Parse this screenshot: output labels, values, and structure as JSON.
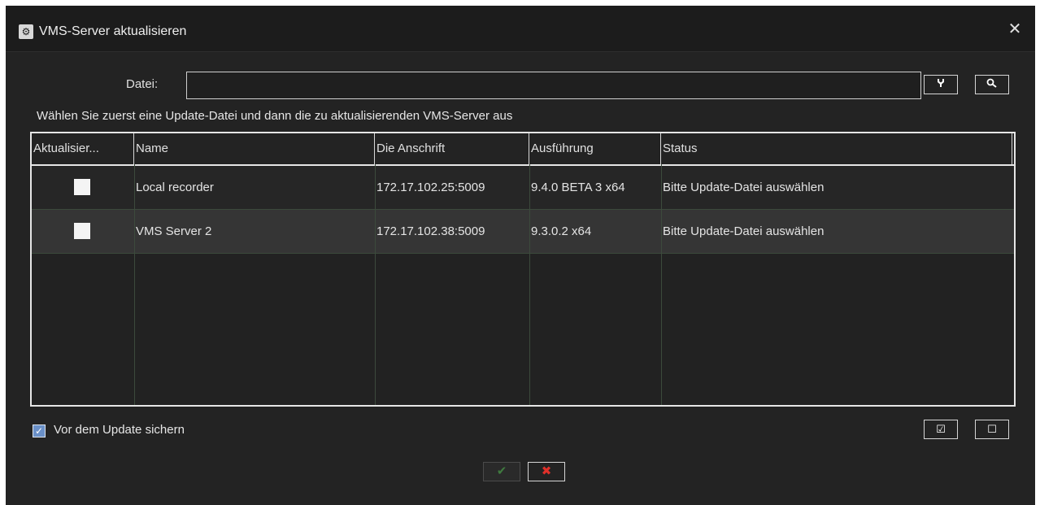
{
  "window": {
    "title": "VMS-Server aktualisieren",
    "close_glyph": "✕",
    "title_icon": "gear-icon"
  },
  "file": {
    "label": "Datei:",
    "value": "",
    "placeholder": "",
    "browse_icon": "wrench-icon",
    "search_icon": "search-icon"
  },
  "hint": "Wählen Sie zuerst eine Update-Datei und dann die zu aktualisierenden VMS-Server aus",
  "table": {
    "columns": [
      "Aktualisier...",
      "Name",
      "Die Anschrift",
      "Ausführung",
      "Status"
    ],
    "rows": [
      {
        "checked": false,
        "name": "Local recorder",
        "address": "172.17.102.25:5009",
        "version": "9.4.0 BETA 3 x64",
        "status": "Bitte Update-Datei auswählen"
      },
      {
        "checked": false,
        "name": "VMS Server 2",
        "address": "172.17.102.38:5009",
        "version": "9.3.0.2 x64",
        "status": "Bitte Update-Datei auswählen"
      }
    ]
  },
  "backup": {
    "checked": true,
    "label": "Vor dem Update sichern"
  },
  "select_all_glyph": "☑",
  "deselect_all_glyph": "☐",
  "ok_glyph": "✔",
  "cancel_glyph": "✖",
  "colors": {
    "background": "#232323",
    "checkbox_checked": "#6a90c8",
    "cancel_red": "#e0302a",
    "ok_green": "#3f7a3f"
  }
}
